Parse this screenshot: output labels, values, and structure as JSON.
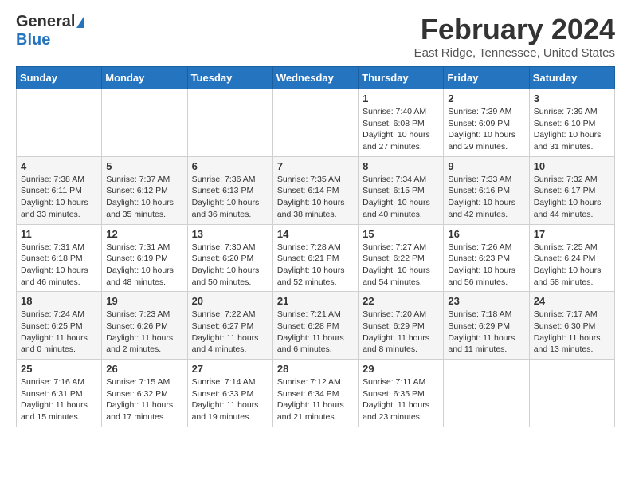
{
  "logo": {
    "general": "General",
    "blue": "Blue"
  },
  "title": "February 2024",
  "subtitle": "East Ridge, Tennessee, United States",
  "days_of_week": [
    "Sunday",
    "Monday",
    "Tuesday",
    "Wednesday",
    "Thursday",
    "Friday",
    "Saturday"
  ],
  "weeks": [
    [
      {
        "day": "",
        "info": ""
      },
      {
        "day": "",
        "info": ""
      },
      {
        "day": "",
        "info": ""
      },
      {
        "day": "",
        "info": ""
      },
      {
        "day": "1",
        "info": "Sunrise: 7:40 AM\nSunset: 6:08 PM\nDaylight: 10 hours and 27 minutes."
      },
      {
        "day": "2",
        "info": "Sunrise: 7:39 AM\nSunset: 6:09 PM\nDaylight: 10 hours and 29 minutes."
      },
      {
        "day": "3",
        "info": "Sunrise: 7:39 AM\nSunset: 6:10 PM\nDaylight: 10 hours and 31 minutes."
      }
    ],
    [
      {
        "day": "4",
        "info": "Sunrise: 7:38 AM\nSunset: 6:11 PM\nDaylight: 10 hours and 33 minutes."
      },
      {
        "day": "5",
        "info": "Sunrise: 7:37 AM\nSunset: 6:12 PM\nDaylight: 10 hours and 35 minutes."
      },
      {
        "day": "6",
        "info": "Sunrise: 7:36 AM\nSunset: 6:13 PM\nDaylight: 10 hours and 36 minutes."
      },
      {
        "day": "7",
        "info": "Sunrise: 7:35 AM\nSunset: 6:14 PM\nDaylight: 10 hours and 38 minutes."
      },
      {
        "day": "8",
        "info": "Sunrise: 7:34 AM\nSunset: 6:15 PM\nDaylight: 10 hours and 40 minutes."
      },
      {
        "day": "9",
        "info": "Sunrise: 7:33 AM\nSunset: 6:16 PM\nDaylight: 10 hours and 42 minutes."
      },
      {
        "day": "10",
        "info": "Sunrise: 7:32 AM\nSunset: 6:17 PM\nDaylight: 10 hours and 44 minutes."
      }
    ],
    [
      {
        "day": "11",
        "info": "Sunrise: 7:31 AM\nSunset: 6:18 PM\nDaylight: 10 hours and 46 minutes."
      },
      {
        "day": "12",
        "info": "Sunrise: 7:31 AM\nSunset: 6:19 PM\nDaylight: 10 hours and 48 minutes."
      },
      {
        "day": "13",
        "info": "Sunrise: 7:30 AM\nSunset: 6:20 PM\nDaylight: 10 hours and 50 minutes."
      },
      {
        "day": "14",
        "info": "Sunrise: 7:28 AM\nSunset: 6:21 PM\nDaylight: 10 hours and 52 minutes."
      },
      {
        "day": "15",
        "info": "Sunrise: 7:27 AM\nSunset: 6:22 PM\nDaylight: 10 hours and 54 minutes."
      },
      {
        "day": "16",
        "info": "Sunrise: 7:26 AM\nSunset: 6:23 PM\nDaylight: 10 hours and 56 minutes."
      },
      {
        "day": "17",
        "info": "Sunrise: 7:25 AM\nSunset: 6:24 PM\nDaylight: 10 hours and 58 minutes."
      }
    ],
    [
      {
        "day": "18",
        "info": "Sunrise: 7:24 AM\nSunset: 6:25 PM\nDaylight: 11 hours and 0 minutes."
      },
      {
        "day": "19",
        "info": "Sunrise: 7:23 AM\nSunset: 6:26 PM\nDaylight: 11 hours and 2 minutes."
      },
      {
        "day": "20",
        "info": "Sunrise: 7:22 AM\nSunset: 6:27 PM\nDaylight: 11 hours and 4 minutes."
      },
      {
        "day": "21",
        "info": "Sunrise: 7:21 AM\nSunset: 6:28 PM\nDaylight: 11 hours and 6 minutes."
      },
      {
        "day": "22",
        "info": "Sunrise: 7:20 AM\nSunset: 6:29 PM\nDaylight: 11 hours and 8 minutes."
      },
      {
        "day": "23",
        "info": "Sunrise: 7:18 AM\nSunset: 6:29 PM\nDaylight: 11 hours and 11 minutes."
      },
      {
        "day": "24",
        "info": "Sunrise: 7:17 AM\nSunset: 6:30 PM\nDaylight: 11 hours and 13 minutes."
      }
    ],
    [
      {
        "day": "25",
        "info": "Sunrise: 7:16 AM\nSunset: 6:31 PM\nDaylight: 11 hours and 15 minutes."
      },
      {
        "day": "26",
        "info": "Sunrise: 7:15 AM\nSunset: 6:32 PM\nDaylight: 11 hours and 17 minutes."
      },
      {
        "day": "27",
        "info": "Sunrise: 7:14 AM\nSunset: 6:33 PM\nDaylight: 11 hours and 19 minutes."
      },
      {
        "day": "28",
        "info": "Sunrise: 7:12 AM\nSunset: 6:34 PM\nDaylight: 11 hours and 21 minutes."
      },
      {
        "day": "29",
        "info": "Sunrise: 7:11 AM\nSunset: 6:35 PM\nDaylight: 11 hours and 23 minutes."
      },
      {
        "day": "",
        "info": ""
      },
      {
        "day": "",
        "info": ""
      }
    ]
  ]
}
